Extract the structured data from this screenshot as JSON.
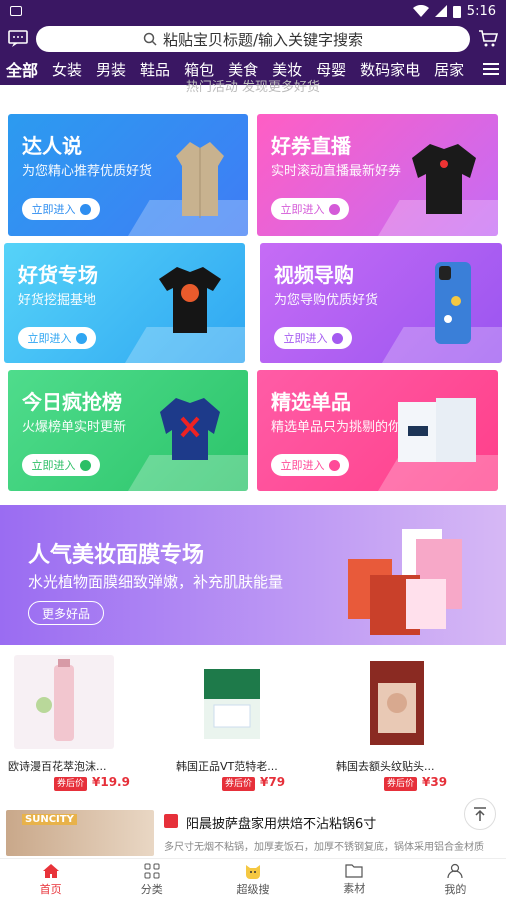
{
  "status_bar": {
    "time": "5:16"
  },
  "search": {
    "placeholder": "粘贴宝贝标题/输入关键字搜索"
  },
  "categories": [
    "全部",
    "女装",
    "男装",
    "鞋品",
    "箱包",
    "美食",
    "美妆",
    "母婴",
    "数码家电",
    "居家"
  ],
  "ghost_text": "热门活动 发现更多好货",
  "cards": [
    {
      "title": "达人说",
      "subtitle": "为您精心推荐优质好货",
      "button": "立即进入"
    },
    {
      "title": "好券直播",
      "subtitle": "实时滚动直播最新好券",
      "button": "立即进入"
    },
    {
      "title": "好货专场",
      "subtitle": "好货挖掘基地",
      "button": "立即进入"
    },
    {
      "title": "视频导购",
      "subtitle": "为您导购优质好货",
      "button": "立即进入"
    },
    {
      "title": "今日疯抢榜",
      "subtitle": "火爆榜单实时更新",
      "button": "立即进入"
    },
    {
      "title": "精选单品",
      "subtitle": "精选单品只为挑剔的你",
      "button": "立即进入"
    }
  ],
  "banner": {
    "title": "人气美妆面膜专场",
    "subtitle": "水光植物面膜细致弹嫩，补充肌肤能量",
    "button": "更多好品"
  },
  "products": [
    {
      "name": "欧诗漫百花萃泡沫...",
      "tag": "券后价",
      "price": "¥19.9"
    },
    {
      "name": "韩国正品VT范特老...",
      "tag": "券后价",
      "price": "¥79"
    },
    {
      "name": "韩国去额头纹贴头...",
      "tag": "券后价",
      "price": "¥39"
    }
  ],
  "feed": {
    "title": "阳晨披萨盘家用烘焙不沾粘锅6寸",
    "desc": "多尺寸无烟不粘锅，加厚麦饭石，加厚不锈钢复底，锅体采用铝合金材质",
    "image_text": "SUNCITY"
  },
  "tabs": [
    {
      "label": "首页",
      "icon": "home-icon"
    },
    {
      "label": "分类",
      "icon": "grid-icon"
    },
    {
      "label": "超级搜",
      "icon": "cat-search-icon"
    },
    {
      "label": "素材",
      "icon": "folder-icon"
    },
    {
      "label": "我的",
      "icon": "user-icon"
    }
  ],
  "colors": {
    "header": "#3a1763",
    "accent": "#e8333a"
  }
}
